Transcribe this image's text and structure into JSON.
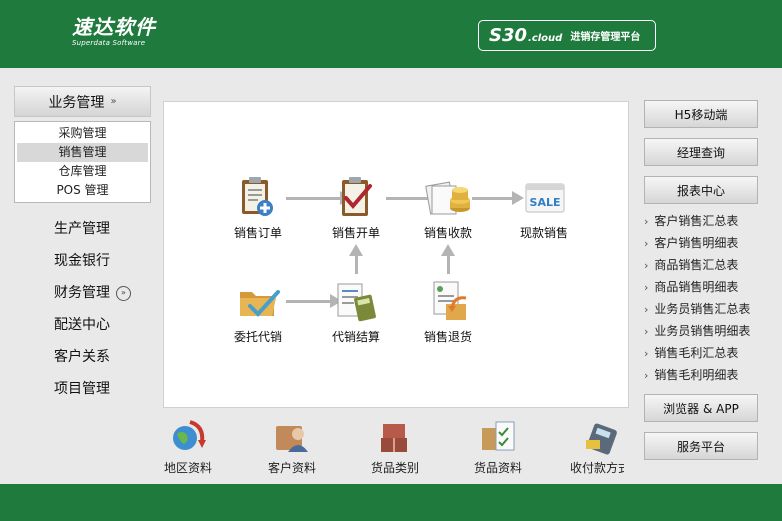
{
  "header": {
    "logo_cn": "速达软件",
    "logo_en": "Superdata Software",
    "brand_main": "S30",
    "brand_suffix": ".cloud",
    "brand_sub": "进销存管理平台"
  },
  "left_menu": {
    "expanded_title": "业务管理",
    "submenu": [
      "采购管理",
      "销售管理",
      "仓库管理",
      "POS 管理"
    ],
    "active_submenu": "销售管理",
    "items": [
      "生产管理",
      "现金银行",
      "财务管理",
      "配送中心",
      "客户关系",
      "项目管理"
    ]
  },
  "flow": {
    "sales_order": "销售订单",
    "sales_invoice": "销售开单",
    "sales_receipt": "销售收款",
    "cash_sales": "现款销售",
    "consignment": "委托代销",
    "consignment_settle": "代销结算",
    "sales_return": "销售退货"
  },
  "bottom_bar": [
    "地区资料",
    "客户资料",
    "货品类别",
    "货品资料",
    "收付款方式"
  ],
  "right_panel": {
    "h5_mobile": "H5移动端",
    "manager_query": "经理查询",
    "report_center": "报表中心",
    "reports": [
      "客户销售汇总表",
      "客户销售明细表",
      "商品销售汇总表",
      "商品销售明细表",
      "业务员销售汇总表",
      "业务员销售明细表",
      "销售毛利汇总表",
      "销售毛利明细表"
    ],
    "browser_app": "浏览器 & APP",
    "service_platform": "服务平台"
  },
  "colors": {
    "brand_green": "#1f7a3d"
  }
}
